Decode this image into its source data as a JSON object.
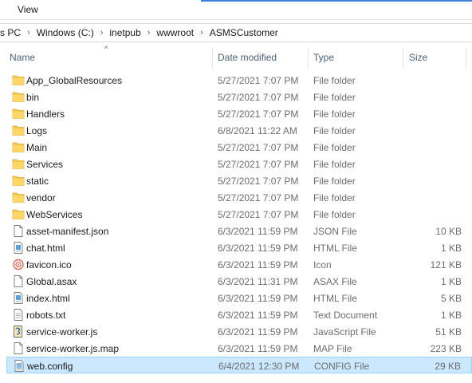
{
  "ribbon": {
    "view_tab": "View"
  },
  "breadcrumbs": [
    "s PC",
    "Windows (C:)",
    "inetpub",
    "wwwroot",
    "ASMSCustomer"
  ],
  "breadcrumb_separator": "›",
  "columns": {
    "name": "Name",
    "date": "Date modified",
    "type": "Type",
    "size": "Size",
    "sort_indicator": "^"
  },
  "files": [
    {
      "name": "App_GlobalResources",
      "date": "5/27/2021 7:07 PM",
      "type": "File folder",
      "size": "",
      "icon": "folder-icon"
    },
    {
      "name": "bin",
      "date": "5/27/2021 7:07 PM",
      "type": "File folder",
      "size": "",
      "icon": "folder-icon"
    },
    {
      "name": "Handlers",
      "date": "5/27/2021 7:07 PM",
      "type": "File folder",
      "size": "",
      "icon": "folder-icon"
    },
    {
      "name": "Logs",
      "date": "6/8/2021 11:22 AM",
      "type": "File folder",
      "size": "",
      "icon": "folder-icon"
    },
    {
      "name": "Main",
      "date": "5/27/2021 7:07 PM",
      "type": "File folder",
      "size": "",
      "icon": "folder-icon"
    },
    {
      "name": "Services",
      "date": "5/27/2021 7:07 PM",
      "type": "File folder",
      "size": "",
      "icon": "folder-icon"
    },
    {
      "name": "static",
      "date": "5/27/2021 7:07 PM",
      "type": "File folder",
      "size": "",
      "icon": "folder-icon"
    },
    {
      "name": "vendor",
      "date": "5/27/2021 7:07 PM",
      "type": "File folder",
      "size": "",
      "icon": "folder-icon"
    },
    {
      "name": "WebServices",
      "date": "5/27/2021 7:07 PM",
      "type": "File folder",
      "size": "",
      "icon": "folder-icon"
    },
    {
      "name": "asset-manifest.json",
      "date": "6/3/2021 11:59 PM",
      "type": "JSON File",
      "size": "10 KB",
      "icon": "document-icon"
    },
    {
      "name": "chat.html",
      "date": "6/3/2021 11:59 PM",
      "type": "HTML File",
      "size": "1 KB",
      "icon": "html-file-icon"
    },
    {
      "name": "favicon.ico",
      "date": "6/3/2021 11:59 PM",
      "type": "Icon",
      "size": "121 KB",
      "icon": "ico-file-icon"
    },
    {
      "name": "Global.asax",
      "date": "6/3/2021 11:31 PM",
      "type": "ASAX File",
      "size": "1 KB",
      "icon": "document-icon"
    },
    {
      "name": "index.html",
      "date": "6/3/2021 11:59 PM",
      "type": "HTML File",
      "size": "5 KB",
      "icon": "html-file-icon"
    },
    {
      "name": "robots.txt",
      "date": "6/3/2021 11:59 PM",
      "type": "Text Document",
      "size": "1 KB",
      "icon": "text-file-icon"
    },
    {
      "name": "service-worker.js",
      "date": "6/3/2021 11:59 PM",
      "type": "JavaScript File",
      "size": "51 KB",
      "icon": "script-file-icon"
    },
    {
      "name": "service-worker.js.map",
      "date": "6/3/2021 11:59 PM",
      "type": "MAP File",
      "size": "223 KB",
      "icon": "document-icon"
    },
    {
      "name": "web.config",
      "date": "6/4/2021 12:30 PM",
      "type": "CONFIG File",
      "size": "29 KB",
      "icon": "config-file-icon",
      "selected": true
    }
  ],
  "colors": {
    "folder": "#f7c94b",
    "selection_bg": "#cce8ff",
    "selection_border": "#99d1ff",
    "header_text": "#4c607a"
  }
}
